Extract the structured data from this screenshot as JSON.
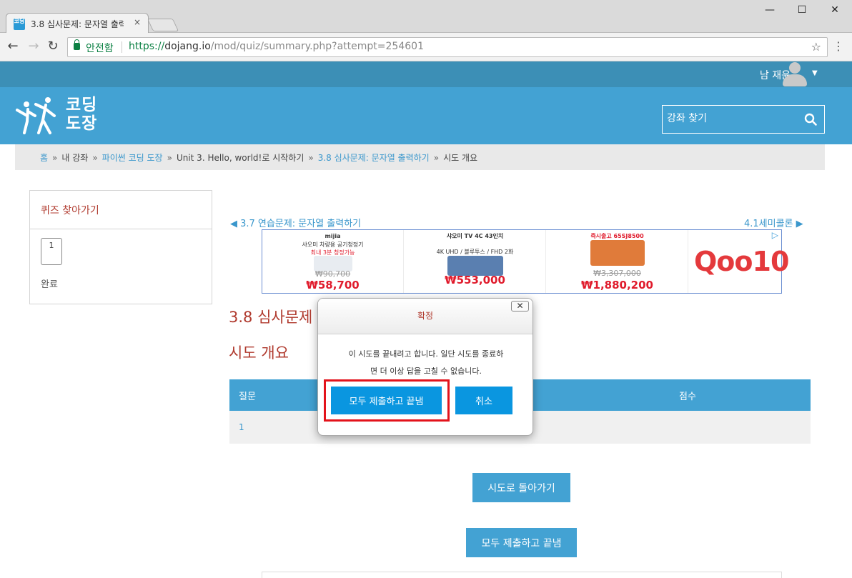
{
  "browser": {
    "tab_title": "3.8 심사문제: 문자열 출력",
    "tab_close": "×",
    "favicon_text": "코딩",
    "secure_label": "안전함",
    "url_scheme": "https://",
    "url_host": "dojang.io",
    "url_path": "/mod/quiz/summary.php?attempt=254601",
    "win_min": "—",
    "win_max": "☐",
    "win_close": "✕",
    "back": "←",
    "forward": "→",
    "reload": "↻",
    "star": "☆",
    "menu": "⋮"
  },
  "user": {
    "name": "남 재윤",
    "caret": "▼"
  },
  "site": {
    "logo_line1": "코딩",
    "logo_line2": "도장",
    "search_placeholder": "강좌 찾기"
  },
  "breadcrumb": {
    "items": [
      {
        "label": "홈",
        "link": true
      },
      {
        "label": "내 강좌",
        "link": false
      },
      {
        "label": "파이썬 코딩 도장",
        "link": true
      },
      {
        "label": "Unit 3. Hello, world!로 시작하기",
        "link": false
      },
      {
        "label": "3.8 심사문제: 문자열 출력하기",
        "link": true
      },
      {
        "label": "시도 개요",
        "link": false
      }
    ],
    "separator": "»"
  },
  "quiz_nav": {
    "title": "퀴즈 찾아가기",
    "question_number": "1",
    "finish_label": "완료"
  },
  "pager": {
    "prev": "◀ 3.7 연습문제: 문자열 출력하기",
    "next": "4.1세미콜론 ▶"
  },
  "ad": {
    "items": [
      {
        "brand": "mijia",
        "caption": "샤오미 차량용 공기청정기",
        "sub": "최내 3분 청정가능",
        "old_price": "₩90,700",
        "new_price": "₩58,700"
      },
      {
        "brand": "mi",
        "caption": "샤오미 TV 4C 43인치",
        "sub": "4K UHD / 블루투스 / FHD 2화",
        "old_price": "",
        "new_price": "₩553,000"
      },
      {
        "brand": "",
        "caption": "즉시출고 65SJ8500",
        "sub": "",
        "old_price": "₩3,307,000",
        "new_price": "₩1,880,200"
      }
    ],
    "logo": "Qoo10",
    "choice": "▷"
  },
  "main": {
    "quiz_title": "3.8 심사문제",
    "summary_title": "시도 개요",
    "table": {
      "headers": [
        "질문",
        "점수"
      ],
      "rows": [
        [
          "1",
          ""
        ]
      ]
    },
    "return_button": "시도로 돌아가기",
    "submit_button": "모두 제출하고 끝냄"
  },
  "modal": {
    "title": "확정",
    "close": "✕",
    "message_line1": "이 시도를 끝내려고 합니다. 일단 시도를 종료하",
    "message_line2": "면 더 이상 답을 고칠 수 없습니다.",
    "submit_button": "모두 제출하고 끝냄",
    "cancel_button": "취소"
  },
  "colors": {
    "header_blue": "#43a2d3",
    "topbar_blue": "#3c8fb6",
    "title_red": "#b03a2e",
    "link_blue": "#3a97cc",
    "modal_button": "#0a96e0",
    "highlight_red": "#e3131b"
  }
}
